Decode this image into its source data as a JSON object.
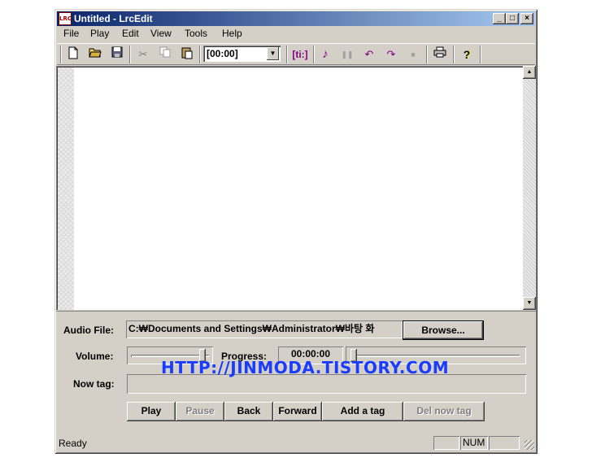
{
  "window": {
    "title": "Untitled - LrcEdit",
    "icon_text": "LRC",
    "minimize": "_",
    "maximize": "□",
    "close": "×"
  },
  "menu": [
    "File",
    "Play",
    "Edit",
    "View",
    "Tools",
    "Help"
  ],
  "toolbar": {
    "time_combo_value": "[00:00]",
    "ti_label": "[ti:]",
    "icons": [
      "new-file-icon",
      "open-folder-icon",
      "save-icon",
      "cut-icon",
      "copy-icon",
      "paste-icon",
      "ti-tag-icon",
      "music-note-icon",
      "pause-icon",
      "undo-icon",
      "redo-icon",
      "stop-icon",
      "print-icon",
      "help-icon"
    ]
  },
  "panel": {
    "audio_file_label": "Audio File:",
    "audio_file_path": "C:₩Documents and Settings₩Administrator₩바탕 화",
    "browse_label": "Browse...",
    "volume_label": "Volume:",
    "volume_level": 0.95,
    "progress_label": "Progress:",
    "progress_time": "00:00:00",
    "progress_level": 0.0,
    "now_tag_label": "Now tag:",
    "now_tag_value": "",
    "buttons": {
      "play": "Play",
      "pause": "Pause",
      "back": "Back",
      "forward": "Forward",
      "add_tag": "Add a tag",
      "del_tag": "Del now tag"
    }
  },
  "status": {
    "text": "Ready",
    "num": "NUM"
  },
  "watermark": "HTTP://JINMODA.TISTORY.COM"
}
